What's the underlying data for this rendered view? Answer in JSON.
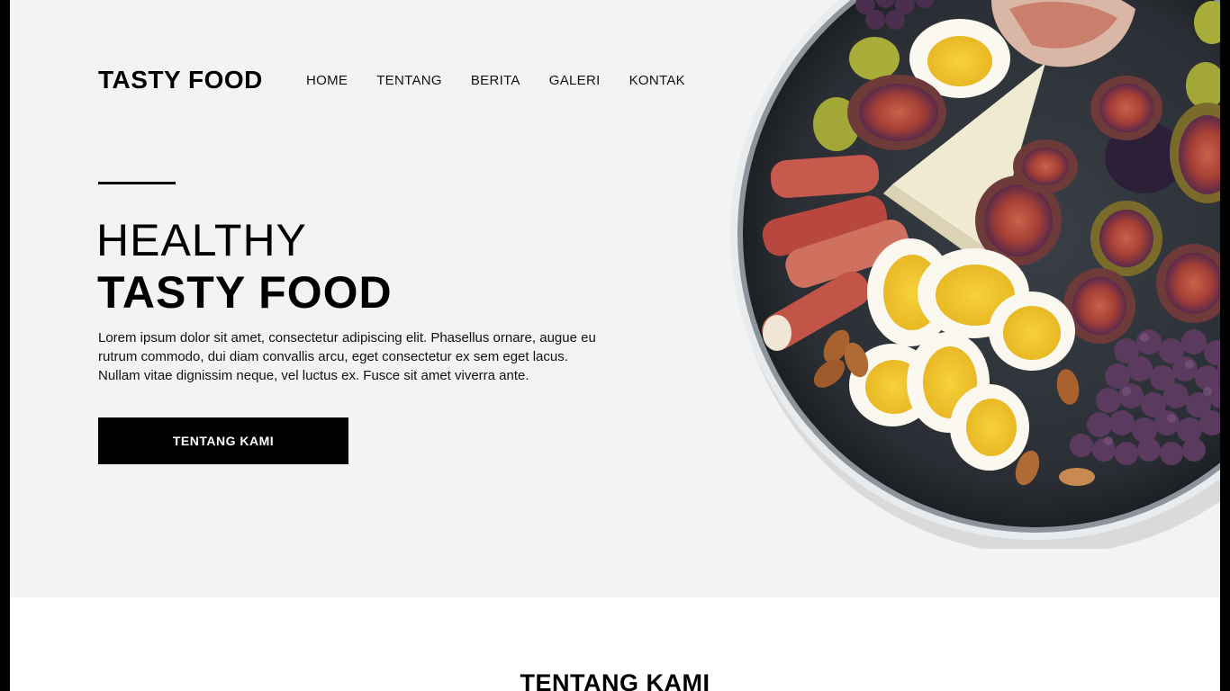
{
  "header": {
    "logo": "TASTY FOOD",
    "nav": [
      "HOME",
      "TENTANG",
      "BERITA",
      "GALERI",
      "KONTAK"
    ]
  },
  "hero": {
    "title_line1": "HEALTHY",
    "title_line2": "TASTY FOOD",
    "description": "Lorem ipsum dolor sit amet, consectetur adipiscing elit. Phasellus ornare, augue eu rutrum commodo, dui diam convallis arcu, eget consectetur ex sem eget lacus. Nullam vitae dignissim neque, vel luctus ex. Fusce sit amet viverra ante.",
    "cta_label": "TENTANG KAMI",
    "image_icon": "food-plate-photo"
  },
  "about": {
    "title": "TENTANG KAMI"
  },
  "colors": {
    "hero_bg": "#f3f3f3",
    "button_bg": "#000000",
    "button_text": "#ffffff",
    "page_bg": "#ffffff",
    "frame": "#000000"
  }
}
